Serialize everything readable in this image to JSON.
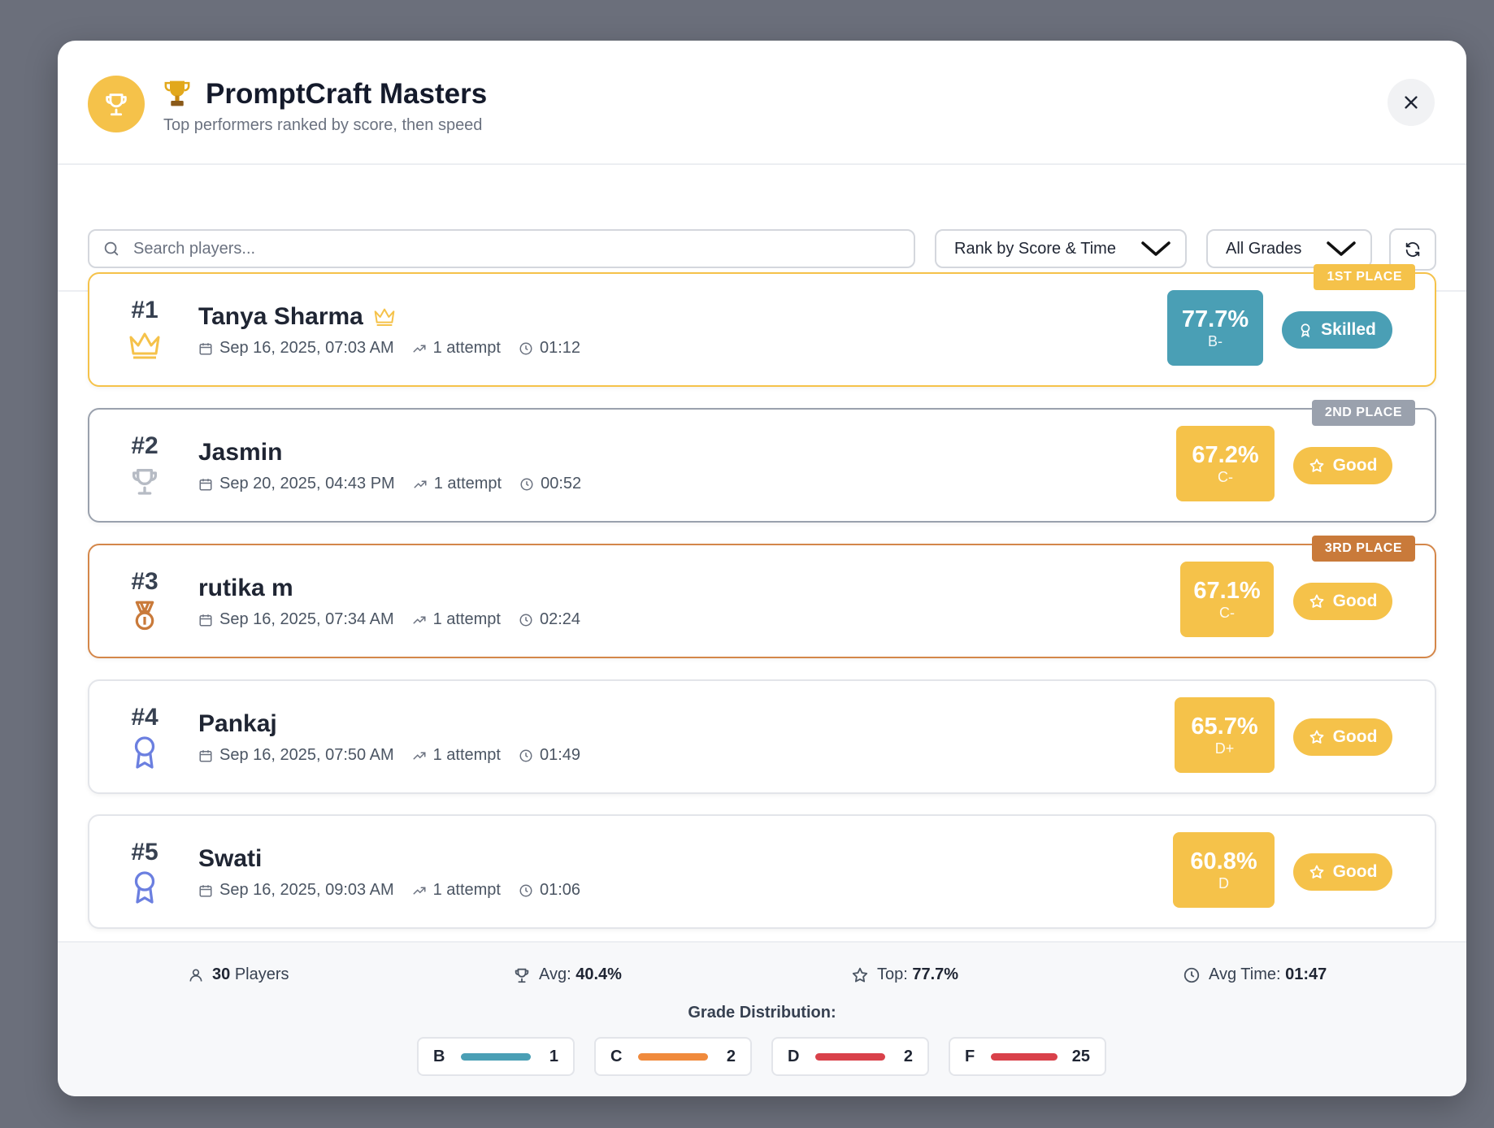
{
  "header": {
    "title": "PromptCraft Masters",
    "subtitle": "Top performers ranked by score, then speed"
  },
  "toolbar": {
    "search_placeholder": "Search players...",
    "sort_selected": "Rank by Score & Time",
    "grade_filter_selected": "All Grades"
  },
  "players": [
    {
      "rank": "#1",
      "name": "Tanya Sharma",
      "date": "Sep 16, 2025, 07:03 AM",
      "attempts": "1 attempt",
      "time": "01:12",
      "score": "77.7%",
      "grade": "B-",
      "badge": "Skilled",
      "ribbon": "1ST PLACE"
    },
    {
      "rank": "#2",
      "name": "Jasmin",
      "date": "Sep 20, 2025, 04:43 PM",
      "attempts": "1 attempt",
      "time": "00:52",
      "score": "67.2%",
      "grade": "C-",
      "badge": "Good",
      "ribbon": "2ND PLACE"
    },
    {
      "rank": "#3",
      "name": "rutika m",
      "date": "Sep 16, 2025, 07:34 AM",
      "attempts": "1 attempt",
      "time": "02:24",
      "score": "67.1%",
      "grade": "C-",
      "badge": "Good",
      "ribbon": "3RD PLACE"
    },
    {
      "rank": "#4",
      "name": "Pankaj",
      "date": "Sep 16, 2025, 07:50 AM",
      "attempts": "1 attempt",
      "time": "01:49",
      "score": "65.7%",
      "grade": "D+",
      "badge": "Good"
    },
    {
      "rank": "#5",
      "name": "Swati",
      "date": "Sep 16, 2025, 09:03 AM",
      "attempts": "1 attempt",
      "time": "01:06",
      "score": "60.8%",
      "grade": "D",
      "badge": "Good"
    }
  ],
  "footer": {
    "players_count": "30",
    "players_label": "Players",
    "avg_label": "Avg:",
    "avg_value": "40.4%",
    "top_label": "Top:",
    "top_value": "77.7%",
    "avg_time_label": "Avg Time:",
    "avg_time_value": "01:47",
    "distribution_title": "Grade Distribution:",
    "distribution": [
      {
        "grade": "B",
        "count": "1",
        "color": "#4a9fb5"
      },
      {
        "grade": "C",
        "count": "2",
        "color": "#f08a3c"
      },
      {
        "grade": "D",
        "count": "2",
        "color": "#d9414a"
      },
      {
        "grade": "F",
        "count": "25",
        "color": "#d9414a"
      }
    ]
  },
  "colors": {
    "gold": "#f5c24a",
    "silver": "#9aa1ad",
    "bronze": "#c97a3a",
    "skilled": "#4a9fb5",
    "good": "#f5c24a",
    "ribbon_gold": "#f5c24a",
    "ribbon_silver": "#9aa1ad",
    "ribbon_bronze": "#c97a3a"
  },
  "icons": {
    "header": "trophy-icon",
    "rank1": "crown-icon",
    "rank2": "trophy-icon",
    "rank3": "medal-icon",
    "rank4": "award-ribbon-icon",
    "rank5": "award-ribbon-icon"
  }
}
